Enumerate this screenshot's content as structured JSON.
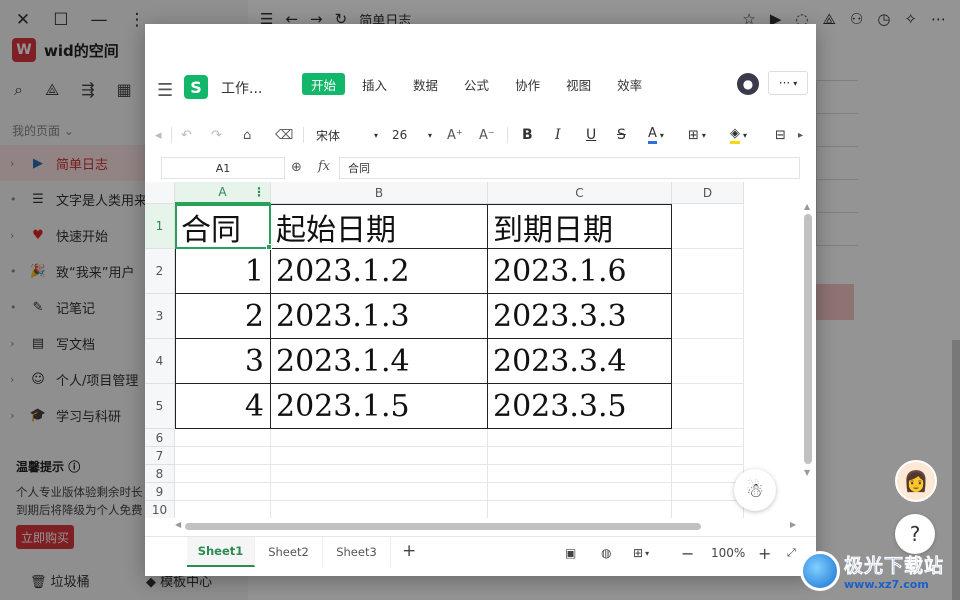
{
  "background_app": {
    "space_logo": "W",
    "space_name": "wid的空间",
    "my_pages_label": "我的页面",
    "nav_items": [
      {
        "label": "简单日志",
        "icon": "▶",
        "arrow": "›"
      },
      {
        "label": "文字是人类用来",
        "icon": "☰",
        "arrow": "•"
      },
      {
        "label": "快速开始",
        "icon": "♥",
        "arrow": "›"
      },
      {
        "label": "致“我来”用户",
        "icon": "🎉",
        "arrow": "•"
      },
      {
        "label": "记笔记",
        "icon": "✎",
        "arrow": "•"
      },
      {
        "label": "写文档",
        "icon": "▤",
        "arrow": "›"
      },
      {
        "label": "个人/项目管理",
        "icon": "☺",
        "arrow": "›"
      },
      {
        "label": "学习与科研",
        "icon": "🎓",
        "arrow": "›"
      }
    ],
    "tip_title": "温馨提示",
    "tip_line1": "个人专业版体验剩余时长",
    "tip_line2": "到期后将降级为个人免费",
    "buy_label": "立即购买",
    "trash_label": "垃圾桶",
    "template_label": "模板中心",
    "doc_title": "简单日志"
  },
  "spreadsheet": {
    "file_name": "工作...",
    "menu_tabs": [
      "开始",
      "插入",
      "数据",
      "公式",
      "协作",
      "视图",
      "效率"
    ],
    "active_tab": "开始",
    "more_label": "···",
    "font_name": "宋体",
    "font_size": "26",
    "cell_ref": "A1",
    "fx_symbol": "fx",
    "formula_value": "合同",
    "columns": [
      "A",
      "B",
      "C",
      "D"
    ],
    "row_numbers": [
      "1",
      "2",
      "3",
      "4",
      "5",
      "6",
      "7",
      "8",
      "9",
      "10"
    ],
    "table": {
      "headers": [
        "合同",
        "起始日期",
        "到期日期"
      ],
      "rows": [
        [
          "1",
          "2023.1.2",
          "2023.1.6"
        ],
        [
          "2",
          "2023.1.3",
          "2023.3.3"
        ],
        [
          "3",
          "2023.1.4",
          "2023.3.4"
        ],
        [
          "4",
          "2023.1.5",
          "2023.3.5"
        ]
      ]
    },
    "sheets": [
      "Sheet1",
      "Sheet2",
      "Sheet3"
    ],
    "active_sheet": "Sheet1",
    "zoom": "100%",
    "accent_color": "#12b76a"
  },
  "watermark": {
    "text": "极光下载站",
    "url": "www.xz7.com"
  }
}
